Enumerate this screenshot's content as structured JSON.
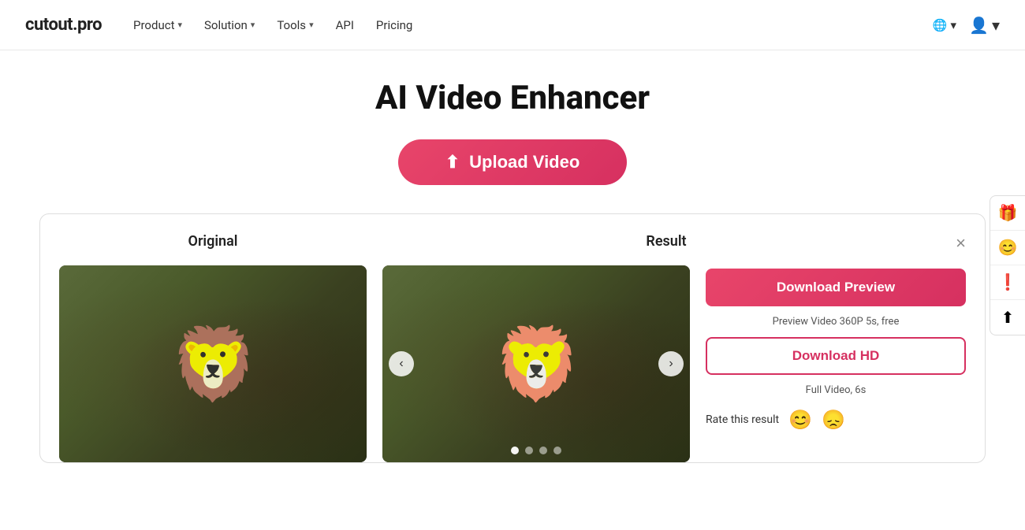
{
  "navbar": {
    "logo": "cutout.pro",
    "nav_items": [
      {
        "label": "Product",
        "has_dropdown": true
      },
      {
        "label": "Solution",
        "has_dropdown": true
      },
      {
        "label": "Tools",
        "has_dropdown": true
      },
      {
        "label": "API",
        "has_dropdown": false
      },
      {
        "label": "Pricing",
        "has_dropdown": false
      }
    ],
    "lang_icon": "🌐",
    "lang_chevron": "▾",
    "user_icon": "👤",
    "user_chevron": "▾"
  },
  "hero": {
    "title": "AI Video Enhancer",
    "upload_button_label": "Upload Video",
    "upload_icon": "⬆"
  },
  "comparison": {
    "original_label": "Original",
    "result_label": "Result",
    "close_label": "×",
    "nav_prev": "‹",
    "nav_next": "›",
    "dots": [
      {
        "active": false
      },
      {
        "active": false
      },
      {
        "active": false
      },
      {
        "active": false
      }
    ],
    "download_preview_label": "Download Preview",
    "preview_description": "Preview Video 360P 5s, free",
    "download_hd_label": "Download HD",
    "hd_description": "Full Video, 6s",
    "rate_label": "Rate this result",
    "emoji_happy": "😊",
    "emoji_sad": "😞"
  },
  "side_icons": [
    {
      "icon": "🎁",
      "name": "gift-icon"
    },
    {
      "icon": "😊",
      "name": "face-icon"
    },
    {
      "icon": "❗",
      "name": "alert-icon"
    },
    {
      "icon": "⬆",
      "name": "upload-side-icon"
    }
  ]
}
